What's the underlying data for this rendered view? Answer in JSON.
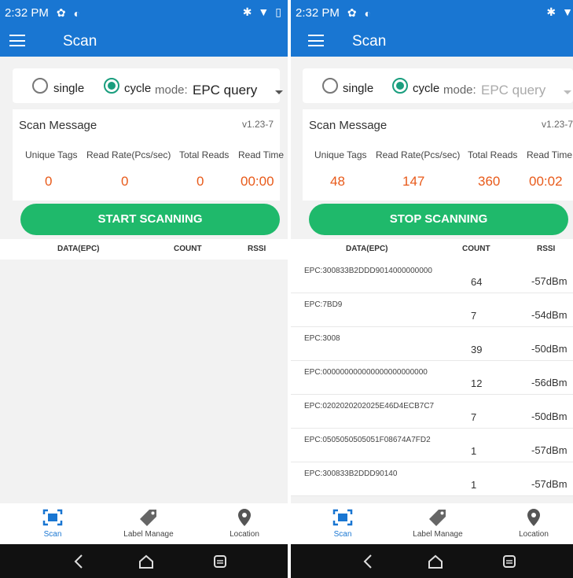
{
  "left": {
    "status": {
      "time": "2:32 PM"
    },
    "appbar": {
      "title": "Scan"
    },
    "mode": {
      "single_label": "single",
      "cycle_label": "cycle",
      "mode_label": "mode:",
      "mode_value": "EPC query",
      "selected": "cycle"
    },
    "message": {
      "title": "Scan Message",
      "version": "v1.23-7",
      "stats": [
        {
          "label": "Unique Tags",
          "value": "0"
        },
        {
          "label": "Read Rate(Pcs/sec)",
          "value": "0"
        },
        {
          "label": "Total Reads",
          "value": "0"
        },
        {
          "label": "Read Time",
          "value": "00:00"
        }
      ]
    },
    "button": {
      "label": "START SCANNING"
    },
    "table": {
      "headers": [
        "DATA(EPC)",
        "COUNT",
        "RSSI"
      ],
      "rows": []
    },
    "nav": [
      {
        "label": "Scan",
        "icon": "scan-icon",
        "active": true
      },
      {
        "label": "Label Manage",
        "icon": "tag-icon",
        "active": false
      },
      {
        "label": "Location",
        "icon": "location-pin-icon",
        "active": false
      }
    ]
  },
  "right": {
    "status": {
      "time": "2:32 PM"
    },
    "appbar": {
      "title": "Scan"
    },
    "mode": {
      "single_label": "single",
      "cycle_label": "cycle",
      "mode_label": "mode:",
      "mode_value": "EPC query",
      "selected": "cycle"
    },
    "message": {
      "title": "Scan Message",
      "version": "v1.23-7",
      "stats": [
        {
          "label": "Unique Tags",
          "value": "48"
        },
        {
          "label": "Read Rate(Pcs/sec)",
          "value": "147"
        },
        {
          "label": "Total Reads",
          "value": "360"
        },
        {
          "label": "Read Time",
          "value": "00:02"
        }
      ]
    },
    "button": {
      "label": "STOP SCANNING"
    },
    "table": {
      "headers": [
        "DATA(EPC)",
        "COUNT",
        "RSSI"
      ],
      "rows": [
        {
          "epc": "EPC:300833B2DDD9014000000000",
          "count": "64",
          "rssi": "-57dBm"
        },
        {
          "epc": "EPC:7BD9",
          "count": "7",
          "rssi": "-54dBm"
        },
        {
          "epc": "EPC:3008",
          "count": "39",
          "rssi": "-50dBm"
        },
        {
          "epc": "EPC:000000000000000000000000",
          "count": "12",
          "rssi": "-56dBm"
        },
        {
          "epc": "EPC:0202020202025E46D4ECB7C7",
          "count": "7",
          "rssi": "-50dBm"
        },
        {
          "epc": "EPC:0505050505051F08674A7FD2",
          "count": "1",
          "rssi": "-57dBm"
        },
        {
          "epc": "EPC:300833B2DDD90140",
          "count": "1",
          "rssi": "-57dBm"
        }
      ]
    },
    "nav": [
      {
        "label": "Scan",
        "icon": "scan-icon",
        "active": true
      },
      {
        "label": "Label Manage",
        "icon": "tag-icon",
        "active": false
      },
      {
        "label": "Location",
        "icon": "location-pin-icon",
        "active": false
      }
    ]
  },
  "colors": {
    "appbar": "#1976d2",
    "button": "#1fb96b",
    "stat_value": "#e85a1a",
    "radio_checked": "#1a9e7e"
  }
}
